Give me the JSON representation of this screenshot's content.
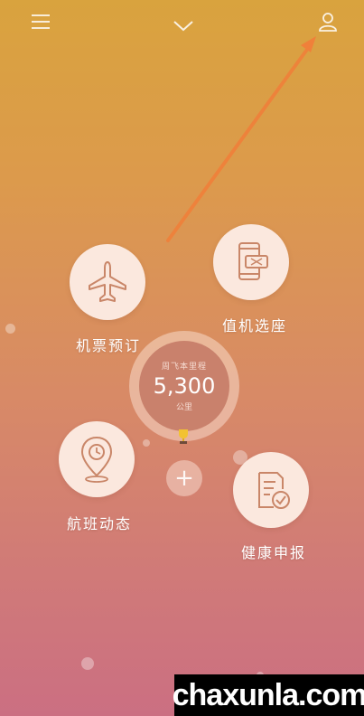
{
  "header": {
    "menu_icon": "menu-icon",
    "dropdown_icon": "chevron-down-icon",
    "profile_icon": "user-icon"
  },
  "features": {
    "flight_booking": {
      "label": "机票预订",
      "icon": "airplane-icon"
    },
    "check_in": {
      "label": "值机选座",
      "icon": "phone-ticket-icon"
    },
    "flight_status": {
      "label": "航班动态",
      "icon": "location-clock-icon"
    },
    "health": {
      "label": "健康申报",
      "icon": "document-check-icon"
    }
  },
  "mileage": {
    "title": "周飞本里程",
    "value": "5,300",
    "unit": "公里",
    "trophy_icon": "trophy-icon"
  },
  "add_button": {
    "label": "+"
  },
  "watermark": {
    "text": "chaxunla.com"
  },
  "colors": {
    "accent_arrow": "#f0803a",
    "icon_stroke": "#c98668",
    "circle_fill": "#fbe8de"
  }
}
